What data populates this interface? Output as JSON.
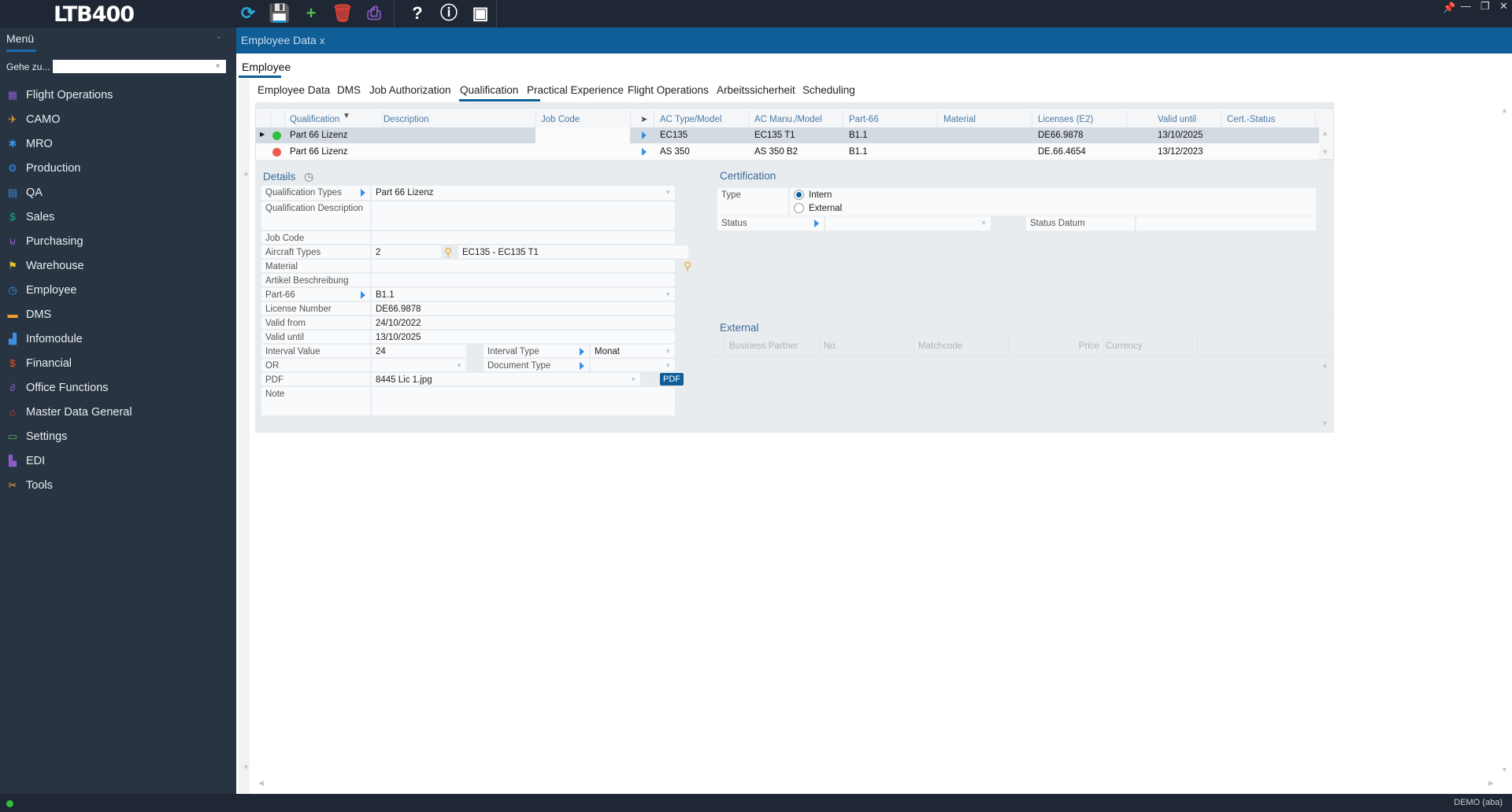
{
  "app": {
    "logo": "LTB400",
    "toolbar": [
      {
        "name": "refresh-icon",
        "glyph": "⟳",
        "color": "#29a8d8"
      },
      {
        "name": "save-icon",
        "glyph": "💾",
        "color": "#3b8ee0"
      },
      {
        "name": "add-icon",
        "glyph": "+",
        "color": "#4cbb4c"
      },
      {
        "name": "delete-icon",
        "glyph": "🗑",
        "color": "#d9423a"
      },
      {
        "name": "print-icon",
        "glyph": "⎙",
        "color": "#8a5ac8"
      },
      {
        "name": "help-icon",
        "glyph": "?",
        "color": "#ffffff"
      },
      {
        "name": "info-icon",
        "glyph": "ⓘ",
        "color": "#ffffff"
      },
      {
        "name": "image-icon",
        "glyph": "▣",
        "color": "#ffffff"
      }
    ]
  },
  "sidebar": {
    "title": "Menü",
    "goto_label": "Gehe zu...",
    "goto_value": "",
    "items": [
      {
        "label": "Flight Operations",
        "icon": "calendar-icon",
        "color": "#8a5ac8"
      },
      {
        "label": "CAMO",
        "icon": "plane-icon",
        "color": "#f0a22c"
      },
      {
        "label": "MRO",
        "icon": "gear-icon",
        "color": "#3b8ee0"
      },
      {
        "label": "Production",
        "icon": "gears-icon",
        "color": "#3b8ee0"
      },
      {
        "label": "QA",
        "icon": "clipboard-icon",
        "color": "#3b8ee0"
      },
      {
        "label": "Sales",
        "icon": "dollar-icon",
        "color": "#2aa79b"
      },
      {
        "label": "Purchasing",
        "icon": "cart-icon",
        "color": "#8a5ac8"
      },
      {
        "label": "Warehouse",
        "icon": "dolly-icon",
        "color": "#e8c52a"
      },
      {
        "label": "Employee",
        "icon": "clock-icon",
        "color": "#3b8ee0"
      },
      {
        "label": "DMS",
        "icon": "folder-icon",
        "color": "#f0a22c"
      },
      {
        "label": "Infomodule",
        "icon": "chart-icon",
        "color": "#3b8ee0"
      },
      {
        "label": "Financial",
        "icon": "money-icon",
        "color": "#e0522c"
      },
      {
        "label": "Office Functions",
        "icon": "paperclip-icon",
        "color": "#8a5ac8"
      },
      {
        "label": "Master Data General",
        "icon": "home-icon",
        "color": "#d9423a"
      },
      {
        "label": "Settings",
        "icon": "monitor-icon",
        "color": "#4cbb4c"
      },
      {
        "label": "EDI",
        "icon": "factory-icon",
        "color": "#8a5ac8"
      },
      {
        "label": "Tools",
        "icon": "tools-icon",
        "color": "#f0a22c"
      }
    ]
  },
  "tabs": {
    "doc_tab": "Employee Data",
    "close": "x",
    "section": "Employee",
    "subtabs": [
      "Employee Data",
      "DMS",
      "Job Authorization",
      "Qualification",
      "Practical Experience",
      "Flight Operations",
      "Arbeitssicherheit",
      "Scheduling"
    ],
    "active_subtab": "Qualification"
  },
  "grid": {
    "columns": [
      "Qualification",
      "Description",
      "Job Code",
      "AC Type/Model",
      "AC Manu./Model",
      "Part-66",
      "Material",
      "Licenses (E2)",
      "Valid until",
      "Cert.-Status"
    ],
    "rows": [
      {
        "status_color": "#2fbf3a",
        "qualification": "Part 66 Lizenz",
        "description": "",
        "job_code": "",
        "ac_type": "EC135",
        "ac_manu": "EC135 T1",
        "part66": "B1.1",
        "material": "",
        "license": "DE66.9878",
        "valid_until": "13/10/2025",
        "cert_status": "",
        "selected": true
      },
      {
        "status_color": "#f05a50",
        "qualification": "Part 66 Lizenz",
        "description": "",
        "job_code": "",
        "ac_type": "AS 350",
        "ac_manu": "AS 350 B2",
        "part66": "B1.1",
        "material": "",
        "license": "DE.66.4654",
        "valid_until": "13/12/2023",
        "cert_status": "",
        "selected": false
      }
    ]
  },
  "details": {
    "title": "Details",
    "qualification_types": {
      "label": "Qualification Types",
      "value": "Part 66 Lizenz"
    },
    "qualification_description": {
      "label": "Qualification Description",
      "value": ""
    },
    "job_code": {
      "label": "Job Code",
      "value": ""
    },
    "aircraft_types": {
      "label": "Aircraft Types",
      "value": "2",
      "text": "EC135 - EC135 T1"
    },
    "material": {
      "label": "Material",
      "value": ""
    },
    "artikel": {
      "label": "Artikel Beschreibung",
      "value": ""
    },
    "part66": {
      "label": "Part-66",
      "value": "B1.1"
    },
    "license_number": {
      "label": "License Number",
      "value": "DE66.9878"
    },
    "valid_from": {
      "label": "Valid from",
      "value": "24/10/2022"
    },
    "valid_until": {
      "label": "Valid until",
      "value": "13/10/2025"
    },
    "interval_value": {
      "label": "Interval Value",
      "value": "24"
    },
    "interval_type": {
      "label": "Interval Type",
      "value": "Monat"
    },
    "or": {
      "label": "OR",
      "value": ""
    },
    "document_type": {
      "label": "Document Type",
      "value": ""
    },
    "pdf": {
      "label": "PDF",
      "value": "8445  Lic 1.jpg",
      "button": "PDF"
    },
    "note": {
      "label": "Note",
      "value": ""
    }
  },
  "certification": {
    "title": "Certification",
    "type_label": "Type",
    "options": [
      "Intern",
      "External"
    ],
    "selected": "Intern",
    "status_label": "Status",
    "status_value": "",
    "status_datum_label": "Status Datum",
    "status_datum_value": ""
  },
  "external": {
    "title": "External",
    "columns": [
      "Business Partner",
      "No.",
      "Matchcode",
      "Price",
      "Currency"
    ]
  },
  "status_bar": {
    "user": "DEMO (aba)",
    "online_color": "#2fbf3a"
  }
}
